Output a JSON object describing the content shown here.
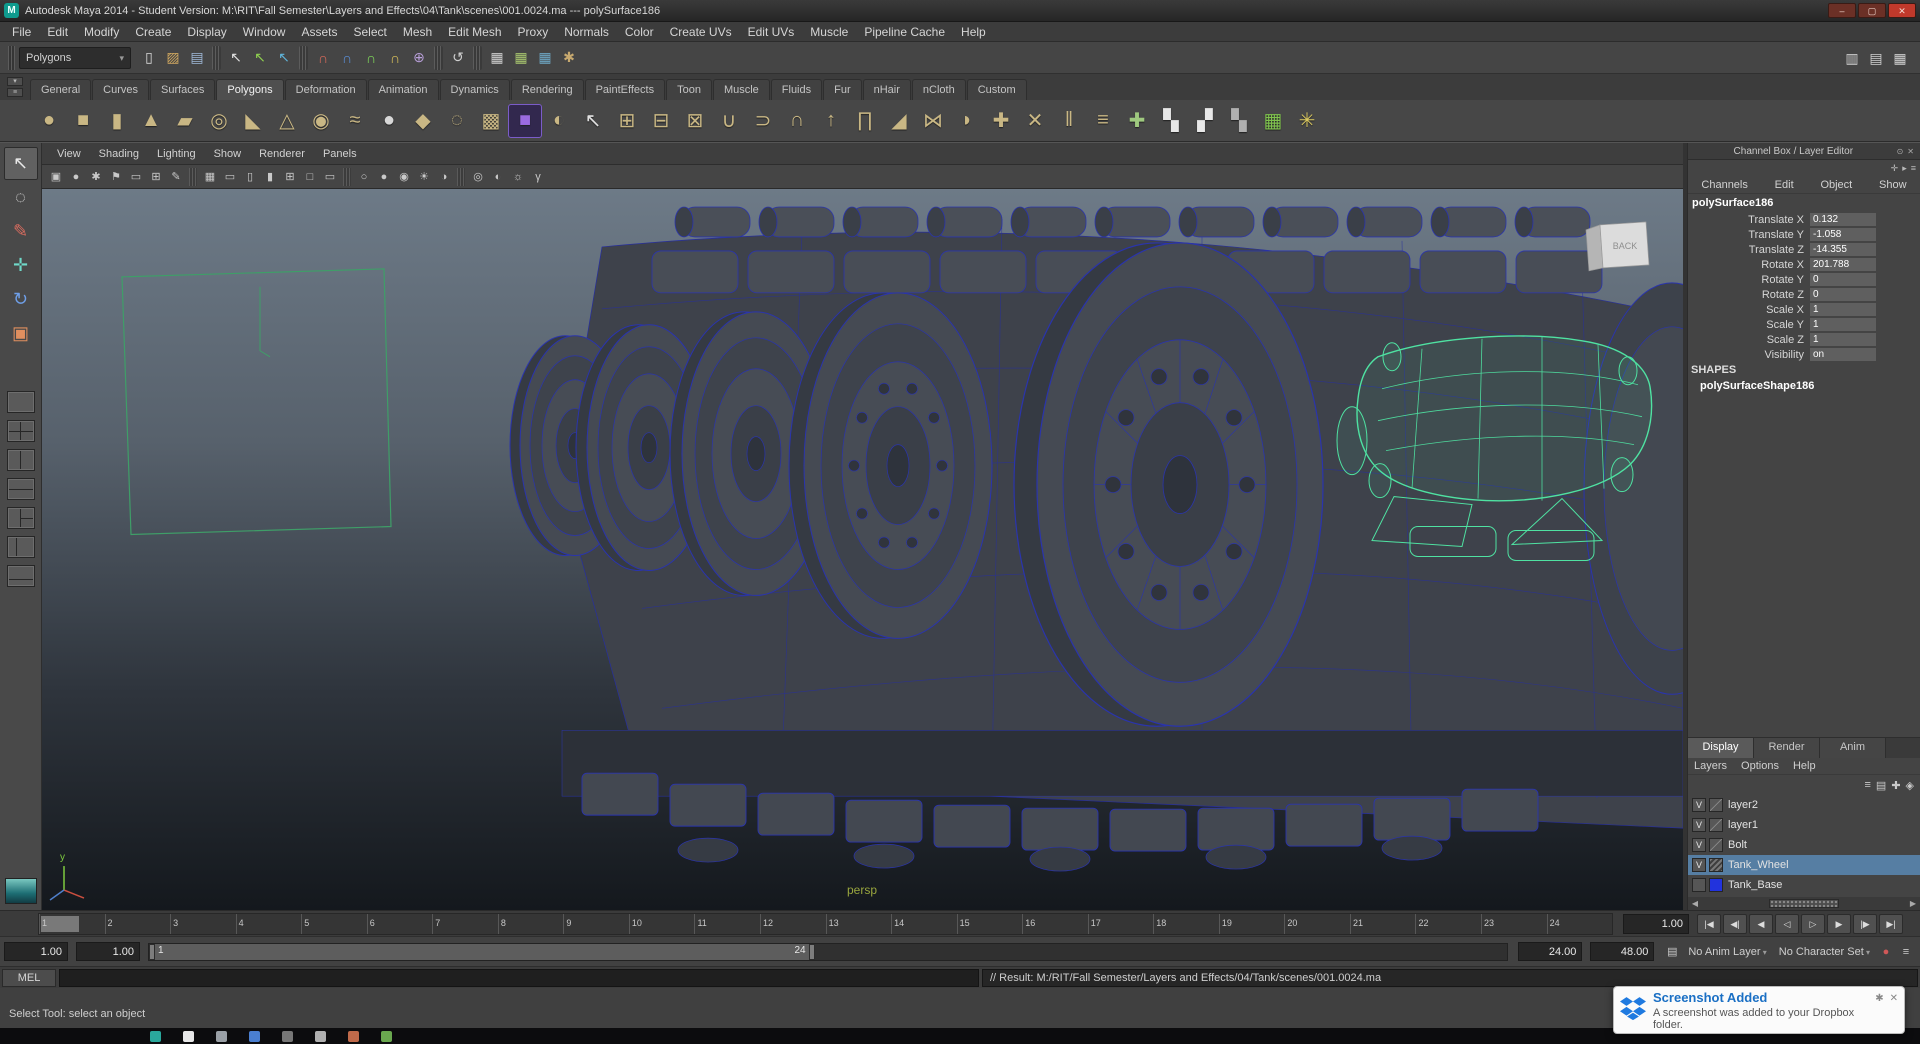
{
  "window": {
    "title": "Autodesk Maya 2014 - Student Version: M:\\RIT\\Fall Semester\\Layers and Effects\\04\\Tank\\scenes\\001.0024.ma  ---  polySurface186",
    "buttons": [
      {
        "name": "minimize-button",
        "glyph": "–"
      },
      {
        "name": "maximize-button",
        "glyph": "▢"
      },
      {
        "name": "close-button",
        "glyph": "✕"
      }
    ]
  },
  "menubar": {
    "items": [
      "File",
      "Edit",
      "Modify",
      "Create",
      "Display",
      "Window",
      "Assets",
      "Select",
      "Mesh",
      "Edit Mesh",
      "Proxy",
      "Normals",
      "Color",
      "Create UVs",
      "Edit UVs",
      "Muscle",
      "Pipeline Cache",
      "Help"
    ]
  },
  "status": {
    "mode": "Polygons",
    "icons": [
      {
        "name": "new-scene-icon",
        "glyph": "▯",
        "color": "#d8d8d8"
      },
      {
        "name": "open-scene-icon",
        "glyph": "▨",
        "color": "#d0a860"
      },
      {
        "name": "save-scene-icon",
        "glyph": "▤",
        "color": "#9fb9d8"
      },
      {
        "name": "group-separator",
        "sep": true,
        "glyph": ""
      },
      {
        "name": "select-by-hierarchy-icon",
        "glyph": "↖",
        "color": "#e0e0e0"
      },
      {
        "name": "select-by-object-icon",
        "glyph": "↖",
        "color": "#8fd14f"
      },
      {
        "name": "select-by-component-icon",
        "glyph": "↖",
        "color": "#5fb4d9"
      },
      {
        "name": "group-separator",
        "sep": true,
        "glyph": ""
      },
      {
        "name": "snap-to-grid-icon",
        "glyph": "∩",
        "color": "#d96a5a"
      },
      {
        "name": "snap-to-curve-icon",
        "glyph": "∩",
        "color": "#5a8fd9"
      },
      {
        "name": "snap-to-point-icon",
        "glyph": "∩",
        "color": "#7fd95a"
      },
      {
        "name": "snap-to-plane-icon",
        "glyph": "∩",
        "color": "#d9c05a"
      },
      {
        "name": "make-live-icon",
        "glyph": "⊕",
        "color": "#b89fd9"
      },
      {
        "name": "group-separator",
        "sep": true,
        "glyph": ""
      },
      {
        "name": "construction-history-icon",
        "glyph": "↺",
        "color": "#cfcfcf"
      },
      {
        "name": "group-separator",
        "sep": true,
        "glyph": ""
      },
      {
        "name": "render-view-icon",
        "glyph": "▦",
        "color": "#cfcfcf"
      },
      {
        "name": "render-current-frame-icon",
        "glyph": "▦",
        "color": "#a9c76f"
      },
      {
        "name": "ipr-render-icon",
        "glyph": "▦",
        "color": "#6fa9c7"
      },
      {
        "name": "render-settings-icon",
        "glyph": "✱",
        "color": "#c7a96f"
      }
    ],
    "right_icons": [
      {
        "name": "show-channel-box-icon",
        "glyph": "▥",
        "color": "#cfcfcf"
      },
      {
        "name": "show-attribute-editor-icon",
        "glyph": "▤",
        "color": "#cfcfcf"
      },
      {
        "name": "show-tool-settings-icon",
        "glyph": "▦",
        "color": "#cfcfcf"
      }
    ]
  },
  "shelf": {
    "active_tab": "Polygons",
    "tabs": [
      "General",
      "Curves",
      "Surfaces",
      "Polygons",
      "Deformation",
      "Animation",
      "Dynamics",
      "Rendering",
      "PaintEffects",
      "Toon",
      "Muscle",
      "Fluids",
      "Fur",
      "nHair",
      "nCloth",
      "Custom"
    ],
    "mini_buttons": [
      {
        "name": "shelf-tab-cycle-button",
        "glyph": "▾"
      },
      {
        "name": "shelf-menu-button",
        "glyph": "≡"
      }
    ],
    "icons": [
      {
        "name": "poly-sphere-icon",
        "glyph": "●",
        "color": "#c9b784"
      },
      {
        "name": "poly-cube-icon",
        "glyph": "■",
        "color": "#c9b784"
      },
      {
        "name": "poly-cylinder-icon",
        "glyph": "▮",
        "color": "#c9b784"
      },
      {
        "name": "poly-cone-icon",
        "glyph": "▲",
        "color": "#c9b784"
      },
      {
        "name": "poly-plane-icon",
        "glyph": "▰",
        "color": "#c9b784"
      },
      {
        "name": "poly-torus-icon",
        "glyph": "◎",
        "color": "#c9b784"
      },
      {
        "name": "poly-prism-icon",
        "glyph": "◣",
        "color": "#c9b784"
      },
      {
        "name": "poly-pyramid-icon",
        "glyph": "△",
        "color": "#c9b784"
      },
      {
        "name": "poly-pipe-icon",
        "glyph": "◉",
        "color": "#c9b784"
      },
      {
        "name": "poly-helix-icon",
        "glyph": "≈",
        "color": "#c9b784"
      },
      {
        "name": "poly-soccer-ball-icon",
        "glyph": "●",
        "color": "#d8d8d8"
      },
      {
        "name": "poly-platonic-icon",
        "glyph": "◆",
        "color": "#c9b784"
      },
      {
        "name": "smooth-mesh-icon",
        "glyph": "◌",
        "color": "#c9b784"
      },
      {
        "name": "subdiv-proxy-icon",
        "glyph": "▩",
        "color": "#c9b784"
      },
      {
        "name": "smooth-proxy-icon",
        "glyph": "■",
        "color": "#9b6be0",
        "boxed": true
      },
      {
        "name": "sphere-projection-icon",
        "glyph": "◐",
        "color": "#c9b784"
      },
      {
        "name": "shelf-select-icon",
        "glyph": "↖",
        "color": "#e0e0e0"
      },
      {
        "name": "combine-icon",
        "glyph": "⊞",
        "color": "#c9b784"
      },
      {
        "name": "separate-icon",
        "glyph": "⊟",
        "color": "#c9b784"
      },
      {
        "name": "extract-icon",
        "glyph": "⊠",
        "color": "#c9b784"
      },
      {
        "name": "boolean-union-icon",
        "glyph": "∪",
        "color": "#c9b784"
      },
      {
        "name": "boolean-difference-icon",
        "glyph": "⊃",
        "color": "#c9b784"
      },
      {
        "name": "boolean-intersect-icon",
        "glyph": "∩",
        "color": "#c9b784"
      },
      {
        "name": "extrude-icon",
        "glyph": "↑",
        "color": "#c9b784"
      },
      {
        "name": "bridge-icon",
        "glyph": "∏",
        "color": "#c9b784"
      },
      {
        "name": "bevel-icon",
        "glyph": "◢",
        "color": "#c9b784"
      },
      {
        "name": "mirror-geometry-icon",
        "glyph": "⋈",
        "color": "#c9b784"
      },
      {
        "name": "wedge-icon",
        "glyph": "◗",
        "color": "#c9b784"
      },
      {
        "name": "poke-icon",
        "glyph": "✚",
        "color": "#c9b784"
      },
      {
        "name": "cut-faces-icon",
        "glyph": "✕",
        "color": "#c9b784"
      },
      {
        "name": "insert-edge-loop-icon",
        "glyph": "‖",
        "color": "#c9b784"
      },
      {
        "name": "offset-edge-loop-icon",
        "glyph": "≡",
        "color": "#c9b784"
      },
      {
        "name": "append-polygon-icon",
        "glyph": "✚",
        "color": "#9fc97f"
      },
      {
        "name": "uv-checker-a-icon",
        "glyph": "▚",
        "color": "#e8e8e8"
      },
      {
        "name": "uv-checker-b-icon",
        "glyph": "▞",
        "color": "#e8e8e8"
      },
      {
        "name": "uv-checker-c-icon",
        "glyph": "▚",
        "color": "#b0b0b0"
      },
      {
        "name": "uv-grid-icon",
        "glyph": "▦",
        "color": "#7fc24d"
      },
      {
        "name": "normals-display-icon",
        "glyph": "✳",
        "color": "#d9c75f"
      }
    ]
  },
  "toolbox": {
    "tools": [
      {
        "name": "select-tool",
        "glyph": "↖",
        "color": "#e8e8e8",
        "active": true
      },
      {
        "name": "lasso-tool",
        "glyph": "◌",
        "color": "#d8d8d8"
      },
      {
        "name": "paint-select-tool",
        "glyph": "✎",
        "color": "#d96c5f"
      },
      {
        "name": "move-tool",
        "glyph": "✛",
        "color": "#6fd9c9"
      },
      {
        "name": "rotate-tool",
        "glyph": "↻",
        "color": "#6f9fe8"
      },
      {
        "name": "scale-tool",
        "glyph": "▣",
        "color": "#e08f5f"
      }
    ],
    "layouts": [
      {
        "name": "single-pane-layout",
        "variant": "single"
      },
      {
        "name": "four-pane-layout",
        "variant": "four"
      },
      {
        "name": "two-pane-side-layout",
        "variant": "twov"
      },
      {
        "name": "two-pane-stacked-layout",
        "variant": "twoh"
      },
      {
        "name": "three-pane-split-layout",
        "variant": "three"
      },
      {
        "name": "outliner-persp-layout",
        "variant": "left"
      },
      {
        "name": "persp-graph-layout",
        "variant": "bottom"
      }
    ]
  },
  "panel_menu": {
    "items": [
      "View",
      "Shading",
      "Lighting",
      "Show",
      "Renderer",
      "Panels"
    ]
  },
  "panel_toolbar": {
    "icons": [
      {
        "name": "select-camera-icon",
        "glyph": "▣"
      },
      {
        "name": "lock-camera-icon",
        "glyph": "●"
      },
      {
        "name": "camera-attributes-icon",
        "glyph": "✱"
      },
      {
        "name": "bookmark-icon",
        "glyph": "⚑"
      },
      {
        "name": "image-plane-icon",
        "glyph": "▭"
      },
      {
        "name": "two-d-pan-zoom-icon",
        "glyph": "⊞"
      },
      {
        "name": "grease-pencil-icon",
        "glyph": "✎"
      },
      {
        "name": "panel-separator",
        "sep": true,
        "glyph": ""
      },
      {
        "name": "grid-toggle-icon",
        "glyph": "▦"
      },
      {
        "name": "film-gate-icon",
        "glyph": "▭"
      },
      {
        "name": "resolution-gate-icon",
        "glyph": "▯"
      },
      {
        "name": "gate-mask-icon",
        "glyph": "▮"
      },
      {
        "name": "field-chart-icon",
        "glyph": "⊞"
      },
      {
        "name": "safe-action-icon",
        "glyph": "□"
      },
      {
        "name": "safe-title-icon",
        "glyph": "▭"
      },
      {
        "name": "panel-separator",
        "sep": true,
        "glyph": ""
      },
      {
        "name": "wireframe-mode-icon",
        "glyph": "○"
      },
      {
        "name": "smooth-shade-mode-icon",
        "glyph": "●"
      },
      {
        "name": "textured-mode-icon",
        "glyph": "◉"
      },
      {
        "name": "use-all-lights-icon",
        "glyph": "☀"
      },
      {
        "name": "shadows-icon",
        "glyph": "◑"
      },
      {
        "name": "panel-separator",
        "sep": true,
        "glyph": ""
      },
      {
        "name": "isolate-select-icon",
        "glyph": "◎"
      },
      {
        "name": "x-ray-icon",
        "glyph": "◐"
      },
      {
        "name": "exposure-icon",
        "glyph": "☼"
      },
      {
        "name": "gamma-icon",
        "glyph": "γ"
      }
    ]
  },
  "viewport": {
    "camera_label": "persp",
    "viewcube_front": "BACK",
    "axis_y": "y"
  },
  "channel_box": {
    "header": "Channel Box / Layer Editor",
    "header_icons": [
      {
        "name": "pin-icon",
        "glyph": "⊙"
      },
      {
        "name": "close-icon",
        "glyph": "✕"
      }
    ],
    "option_icons": [
      {
        "name": "manipulator-icon",
        "glyph": "✛"
      },
      {
        "name": "speed-icon",
        "glyph": "▸"
      },
      {
        "name": "hyperbolic-icon",
        "glyph": "≡"
      }
    ],
    "menu": [
      "Channels",
      "Edit",
      "Object",
      "Show"
    ],
    "object_name": "polySurface186",
    "attributes": [
      {
        "label": "Translate X",
        "value": "0.132"
      },
      {
        "label": "Translate Y",
        "value": "-1.058"
      },
      {
        "label": "Translate Z",
        "value": "-14.355"
      },
      {
        "label": "Rotate X",
        "value": "201.788"
      },
      {
        "label": "Rotate Y",
        "value": "0"
      },
      {
        "label": "Rotate Z",
        "value": "0"
      },
      {
        "label": "Scale X",
        "value": "1"
      },
      {
        "label": "Scale Y",
        "value": "1"
      },
      {
        "label": "Scale Z",
        "value": "1"
      },
      {
        "label": "Visibility",
        "value": "on"
      }
    ],
    "shapes_header": "SHAPES",
    "shape_name": "polySurfaceShape186"
  },
  "layer_editor": {
    "active_tab": "Display",
    "tabs": [
      "Display",
      "Render",
      "Anim"
    ],
    "menu": [
      "Layers",
      "Options",
      "Help"
    ],
    "icons": [
      {
        "name": "layers-sort-icon",
        "glyph": "≡"
      },
      {
        "name": "empty-layer-icon",
        "glyph": "▤"
      },
      {
        "name": "new-layer-icon",
        "glyph": "✚"
      },
      {
        "name": "new-layer-from-selected-icon",
        "glyph": "◈"
      }
    ],
    "layers": [
      {
        "name": "layer2",
        "visible": "V",
        "selected": false
      },
      {
        "name": "layer1",
        "visible": "V",
        "selected": false
      },
      {
        "name": "Bolt",
        "visible": "V",
        "selected": false
      },
      {
        "name": "Tank_Wheel",
        "visible": "V",
        "selected": true,
        "is_hatch": true
      },
      {
        "name": "Tank_Base",
        "visible": "",
        "selected": false,
        "is_color": true,
        "color": "#2233dd"
      }
    ]
  },
  "timeline": {
    "frames": [
      "1",
      "2",
      "3",
      "4",
      "5",
      "6",
      "7",
      "8",
      "9",
      "10",
      "11",
      "12",
      "13",
      "14",
      "15",
      "16",
      "17",
      "18",
      "19",
      "20",
      "21",
      "22",
      "23",
      "24"
    ],
    "current_time": "1.00",
    "playback_buttons": [
      {
        "name": "go-to-start-button",
        "glyph": "|◀"
      },
      {
        "name": "step-back-frame-button",
        "glyph": "◀|"
      },
      {
        "name": "step-back-key-button",
        "glyph": "◀"
      },
      {
        "name": "play-backwards-button",
        "glyph": "◁"
      },
      {
        "name": "play-forwards-button",
        "glyph": "▷"
      },
      {
        "name": "step-forward-key-button",
        "glyph": "▶"
      },
      {
        "name": "step-forward-frame-button",
        "glyph": "|▶"
      },
      {
        "name": "go-to-end-button",
        "glyph": "▶|"
      }
    ]
  },
  "range_slider": {
    "anim_start": "1.00",
    "playback_start": "1.00",
    "range_start_label": "1",
    "range_end_label": "24",
    "playback_end": "24.00",
    "anim_end": "48.00",
    "anim_layer_menu": "No Anim Layer",
    "character_set_menu": "No Character Set",
    "icons_left": [
      {
        "name": "anim-layer-icon",
        "glyph": "▤",
        "color": "#c9c9c9"
      }
    ],
    "icons_right": [
      {
        "name": "auto-keyframe-icon",
        "glyph": "●",
        "color": "#d05858"
      },
      {
        "name": "animation-preferences-icon",
        "glyph": "≡",
        "color": "#c9c9c9"
      }
    ]
  },
  "command_line": {
    "label": "MEL",
    "input_value": "",
    "result": "// Result: M:/RIT/Fall Semester/Layers and Effects/04/Tank/scenes/001.0024.ma"
  },
  "help_line": {
    "text": "Select Tool: select an object"
  },
  "taskbar": {
    "icons": [
      {
        "name": "taskbar-app-icon",
        "color": "#2aa89c"
      },
      {
        "name": "taskbar-app-icon",
        "color": "#e8e8e8"
      },
      {
        "name": "taskbar-app-icon",
        "color": "#9aa0a6"
      },
      {
        "name": "taskbar-app-icon",
        "color": "#4a7fd0"
      },
      {
        "name": "taskbar-app-icon",
        "color": "#777777"
      },
      {
        "name": "taskbar-app-icon",
        "color": "#b0b0b0"
      },
      {
        "name": "taskbar-app-icon",
        "color": "#c06a4a"
      },
      {
        "name": "taskbar-app-icon",
        "color": "#6aa84f"
      }
    ]
  },
  "notification": {
    "title": "Screenshot Added",
    "body": "A screenshot was added to your Dropbox folder.",
    "options_glyph": "✱",
    "close_glyph": "✕",
    "accent": "#1a6fc4"
  }
}
